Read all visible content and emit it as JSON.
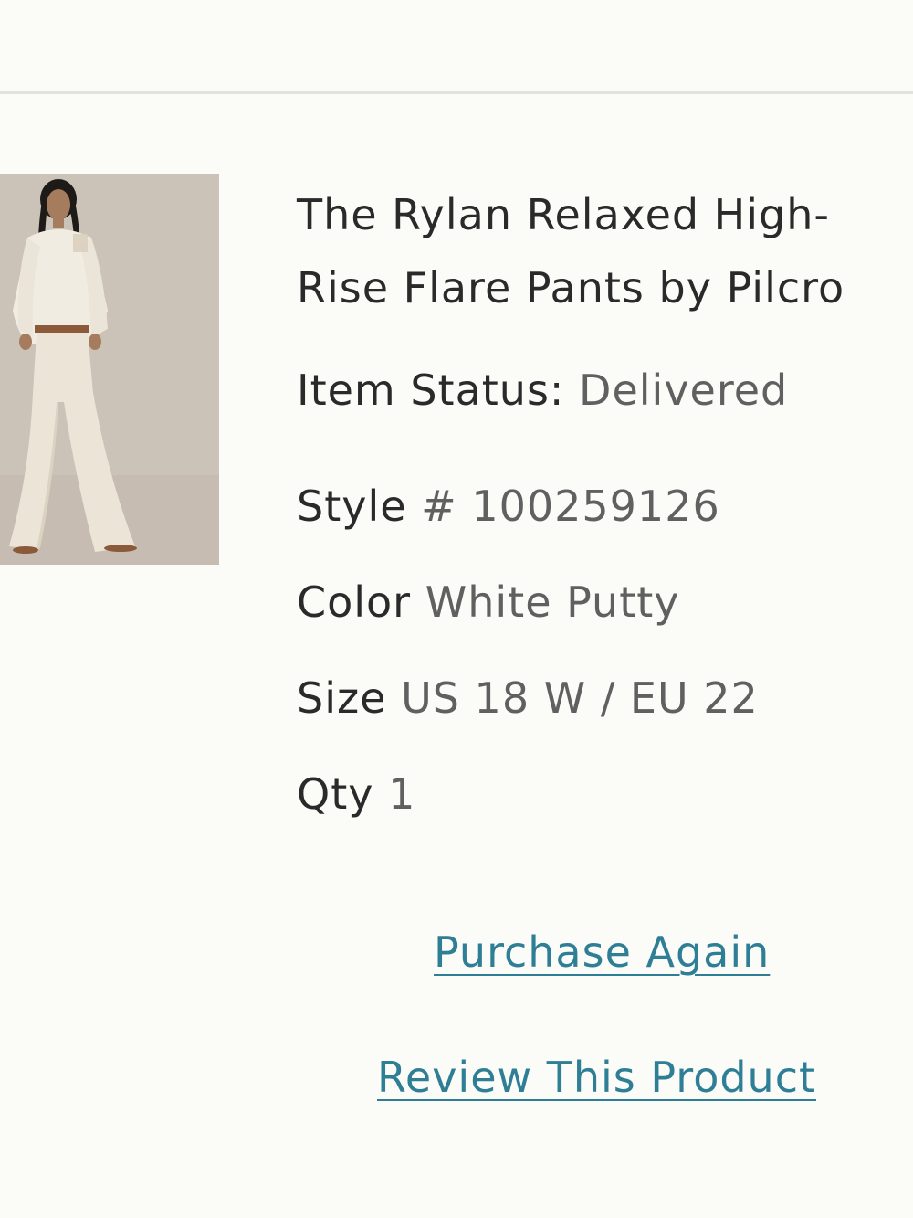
{
  "product": {
    "title_line1": "The Rylan Relaxed High-",
    "title_line2": "Rise Flare Pants by Pilcro",
    "item_status_label": "Item Status:",
    "item_status_value": "Delivered",
    "style_label": "Style",
    "style_value": "# 100259126",
    "color_label": "Color",
    "color_value": "White Putty",
    "size_label": "Size",
    "size_value": "US 18 W / EU 22",
    "qty_label": "Qty",
    "qty_value": "1"
  },
  "actions": {
    "purchase_again": "Purchase Again",
    "review_product": "Review This Product"
  },
  "colors": {
    "background": "#fbfbf8",
    "text_dark": "#2a2a2a",
    "text_muted": "#606060",
    "link": "#2e7f96",
    "divider": "#e1e1de"
  }
}
